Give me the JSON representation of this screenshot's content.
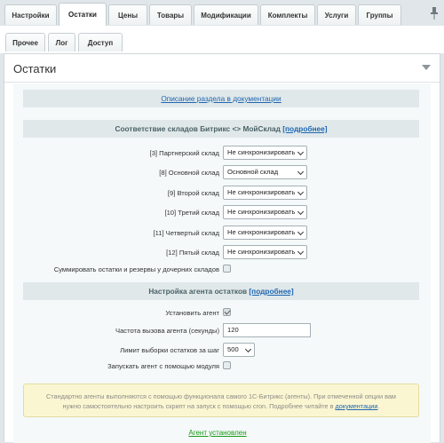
{
  "tabs": [
    "Настройки",
    "Остатки",
    "Цены",
    "Товары",
    "Модификации",
    "Комплекты",
    "Услуги",
    "Группы"
  ],
  "subtabs": [
    "Прочее",
    "Лог",
    "Доступ"
  ],
  "panel": {
    "title": "Остатки"
  },
  "doc_link": "Описание раздела в документации",
  "warehouses_section": {
    "title": "Соответствие складов Битрикс <> МойСклад",
    "more": "[подробнее]"
  },
  "warehouses": [
    {
      "label": "[3] Партнерский склад",
      "value": "Не синхронизировать"
    },
    {
      "label": "[8] Основной склад",
      "value": "Основной склад"
    },
    {
      "label": "[9] Второй склад",
      "value": "Не синхронизировать"
    },
    {
      "label": "[10] Третий склад",
      "value": "Не синхронизировать"
    },
    {
      "label": "[11] Четвертый склад",
      "value": "Не синхронизировать"
    },
    {
      "label": "[12] Пятый склад",
      "value": "Не синхронизировать"
    }
  ],
  "sum_children": {
    "label": "Суммировать остатки и резервы у дочерних складов",
    "checked": false
  },
  "agent_section": {
    "title": "Настройка агента остатков",
    "more": "[подробнее]"
  },
  "agent": {
    "install_label": "Установить агент",
    "install_checked": true,
    "freq_label": "Частота вызова агента (секунды)",
    "freq_value": "120",
    "limit_label": "Лимит выборки остатков за шаг",
    "limit_value": "500",
    "module_label": "Запускать агент с помощью модуля",
    "module_checked": false
  },
  "notice": {
    "line1": "Стандартно агенты выполняются с помощью функционала самого 1С-Битрикс (агенты). При отмеченной опции вам",
    "line2": "нужно самостоятельно настроить скрипт на запуск с помощью cron. Подробнее читайте в",
    "link": "документации",
    "end": "."
  },
  "status": "Агент установлен"
}
